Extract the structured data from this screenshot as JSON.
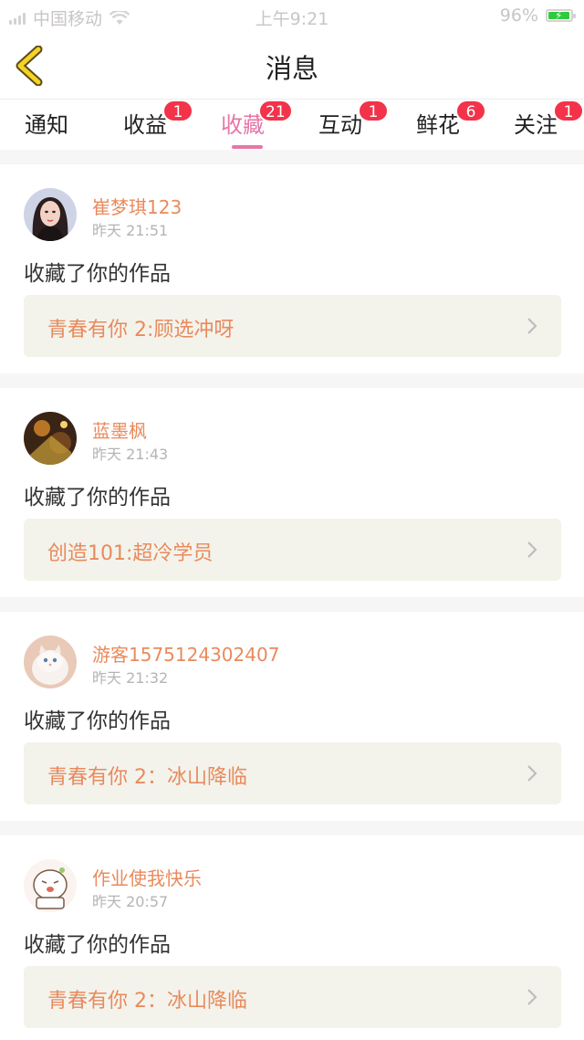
{
  "status_bar": {
    "carrier": "中国移动",
    "time": "上午9:21",
    "battery_percent": "96%",
    "battery_level": 0.96,
    "icons": [
      "signal-icon",
      "wifi-icon",
      "battery-icon"
    ]
  },
  "nav": {
    "title": "消息",
    "back_icon": "chevron-left-icon",
    "accent": "#f5d227"
  },
  "tabs": [
    {
      "label": "通知",
      "badge": ""
    },
    {
      "label": "收益",
      "badge": "1"
    },
    {
      "label": "收藏",
      "badge": "21",
      "active": true
    },
    {
      "label": "互动",
      "badge": "1"
    },
    {
      "label": "鲜花",
      "badge": "6"
    },
    {
      "label": "关注",
      "badge": "1"
    }
  ],
  "colors": {
    "active_tab": "#e676a7",
    "badge": "#f2334a",
    "username": "#e98a5c",
    "work_bg": "#f3f3ec"
  },
  "notifications": [
    {
      "user": "崔梦琪123",
      "time": "昨天 21:51",
      "action": "收藏了你的作品",
      "work": "青春有你 2:顾选冲呀",
      "avatar": "avatar-portrait"
    },
    {
      "user": "蓝墨枫",
      "time": "昨天 21:43",
      "action": "收藏了你的作品",
      "work": "创造101:超冷学员",
      "avatar": "avatar-stage"
    },
    {
      "user": "游客1575124302407",
      "time": "昨天 21:32",
      "action": "收藏了你的作品",
      "work": "青春有你 2：冰山降临",
      "avatar": "avatar-cat"
    },
    {
      "user": "作业使我快乐",
      "time": "昨天 20:57",
      "action": "收藏了你的作品",
      "work": "青春有你 2：冰山降临",
      "avatar": "avatar-cartoon"
    }
  ]
}
